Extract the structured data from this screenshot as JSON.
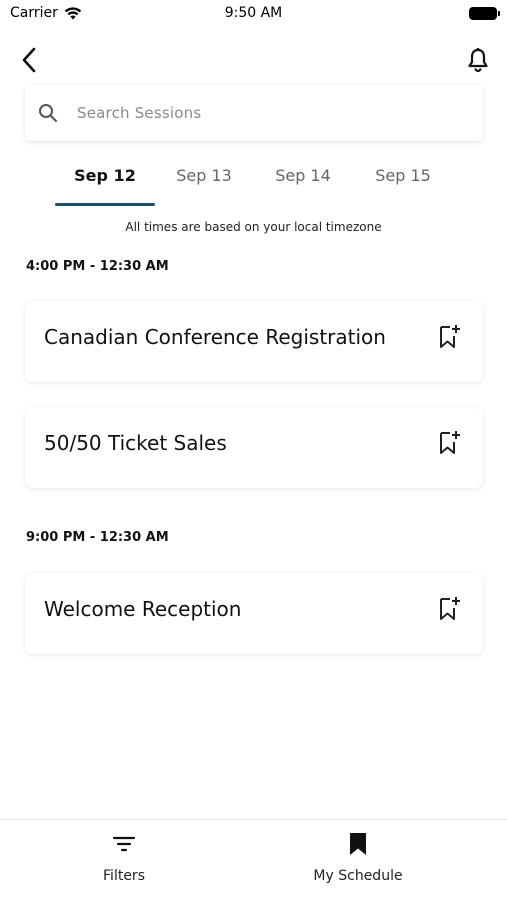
{
  "status_bar": {
    "carrier": "Carrier",
    "time": "9:50 AM"
  },
  "search": {
    "placeholder": "Search Sessions"
  },
  "tabs": [
    {
      "label": "Sep 12",
      "active": true
    },
    {
      "label": "Sep 13",
      "active": false
    },
    {
      "label": "Sep 14",
      "active": false
    },
    {
      "label": "Sep 15",
      "active": false
    }
  ],
  "timezone_note": "All times are based on your local timezone",
  "groups": [
    {
      "time": "4:00 PM - 12:30 AM",
      "sessions": [
        {
          "title": "Canadian Conference Registration"
        },
        {
          "title": "50/50 Ticket Sales"
        }
      ]
    },
    {
      "time": "9:00 PM - 12:30 AM",
      "sessions": [
        {
          "title": "Welcome Reception"
        }
      ]
    }
  ],
  "bottom_nav": {
    "filters_label": "Filters",
    "my_schedule_label": "My Schedule"
  },
  "icons": {
    "back": "chevron-left-icon",
    "bell": "bell-icon",
    "search": "search-icon",
    "bookmark_add": "bookmark-add-icon",
    "filters": "filter-icon",
    "my_schedule": "bookmark-filled-icon"
  },
  "colors": {
    "tab_underline": "#1d4e6b"
  }
}
